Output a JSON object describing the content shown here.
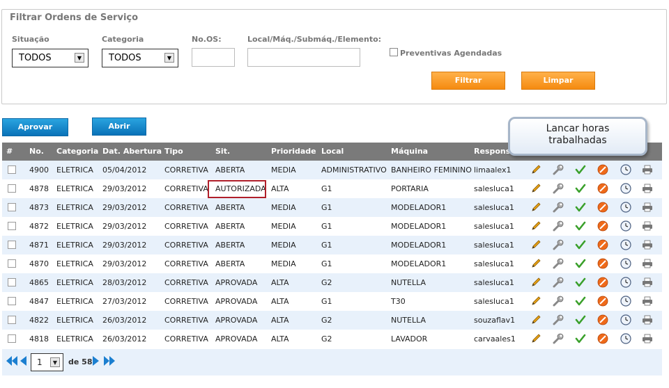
{
  "filter": {
    "legend": "Filtrar Ordens de Serviço",
    "situacao_label": "Situação",
    "situacao_value": "TODOS",
    "categoria_label": "Categoria",
    "categoria_value": "TODOS",
    "nos_label": "No.OS:",
    "nos_value": "",
    "local_label": "Local/Máq./Submáq./Elemento:",
    "local_value": "",
    "preventivas_label": "Preventivas Agendadas",
    "filtrar_label": "Filtrar",
    "limpar_label": "Limpar"
  },
  "actions": {
    "aprovar_label": "Aprovar",
    "abrir_label": "Abrir"
  },
  "tooltip": {
    "line1": "Lancar horas",
    "line2": "trabalhadas"
  },
  "table": {
    "headers": [
      "#",
      "No.",
      "Categoria",
      "Dat. Abertura",
      "Tipo",
      "Sit.",
      "Prioridade",
      "Local",
      "Máquina",
      "Responsáv"
    ],
    "rows": [
      [
        "4900",
        "ELETRICA",
        "05/04/2012",
        "CORRETIVA",
        "ABERTA",
        "MEDIA",
        "ADMINISTRATIVO",
        "BANHEIRO FEMININO",
        "limaalex1"
      ],
      [
        "4878",
        "ELETRICA",
        "29/03/2012",
        "CORRETIVA",
        "AUTORIZADA",
        "ALTA",
        "G1",
        "PORTARIA",
        "salesluca1"
      ],
      [
        "4873",
        "ELETRICA",
        "29/03/2012",
        "CORRETIVA",
        "ABERTA",
        "MEDIA",
        "G1",
        "MODELADOR1",
        "salesluca1"
      ],
      [
        "4872",
        "ELETRICA",
        "29/03/2012",
        "CORRETIVA",
        "ABERTA",
        "MEDIA",
        "G1",
        "MODELADOR1",
        "salesluca1"
      ],
      [
        "4871",
        "ELETRICA",
        "29/03/2012",
        "CORRETIVA",
        "ABERTA",
        "MEDIA",
        "G1",
        "MODELADOR1",
        "salesluca1"
      ],
      [
        "4870",
        "ELETRICA",
        "29/03/2012",
        "CORRETIVA",
        "ABERTA",
        "MEDIA",
        "G1",
        "MODELADOR1",
        "salesluca1"
      ],
      [
        "4865",
        "ELETRICA",
        "28/03/2012",
        "CORRETIVA",
        "APROVADA",
        "ALTA",
        "G2",
        "NUTELLA",
        "salesluca1"
      ],
      [
        "4847",
        "ELETRICA",
        "27/03/2012",
        "CORRETIVA",
        "APROVADA",
        "ALTA",
        "G1",
        "T30",
        "salesluca1"
      ],
      [
        "4822",
        "ELETRICA",
        "26/03/2012",
        "CORRETIVA",
        "APROVADA",
        "ALTA",
        "G2",
        "NUTELLA",
        "souzaflav1"
      ],
      [
        "4818",
        "ELETRICA",
        "26/03/2012",
        "CORRETIVA",
        "APROVADA",
        "ALTA",
        "G2",
        "LAVADOR",
        "carvaales1"
      ]
    ],
    "row_icons": [
      "edit-pencil-icon",
      "wrench-icon",
      "approve-check-icon",
      "cancel-icon",
      "clock-icon",
      "print-icon"
    ]
  },
  "pagination": {
    "page": "1",
    "of_label": "de 58"
  },
  "colors": {
    "orange": "#f58b10",
    "blue": "#0a72b8",
    "header": "#7a7a7a",
    "row_alt": "#e8f1fb",
    "highlight": "#b01f2a"
  }
}
